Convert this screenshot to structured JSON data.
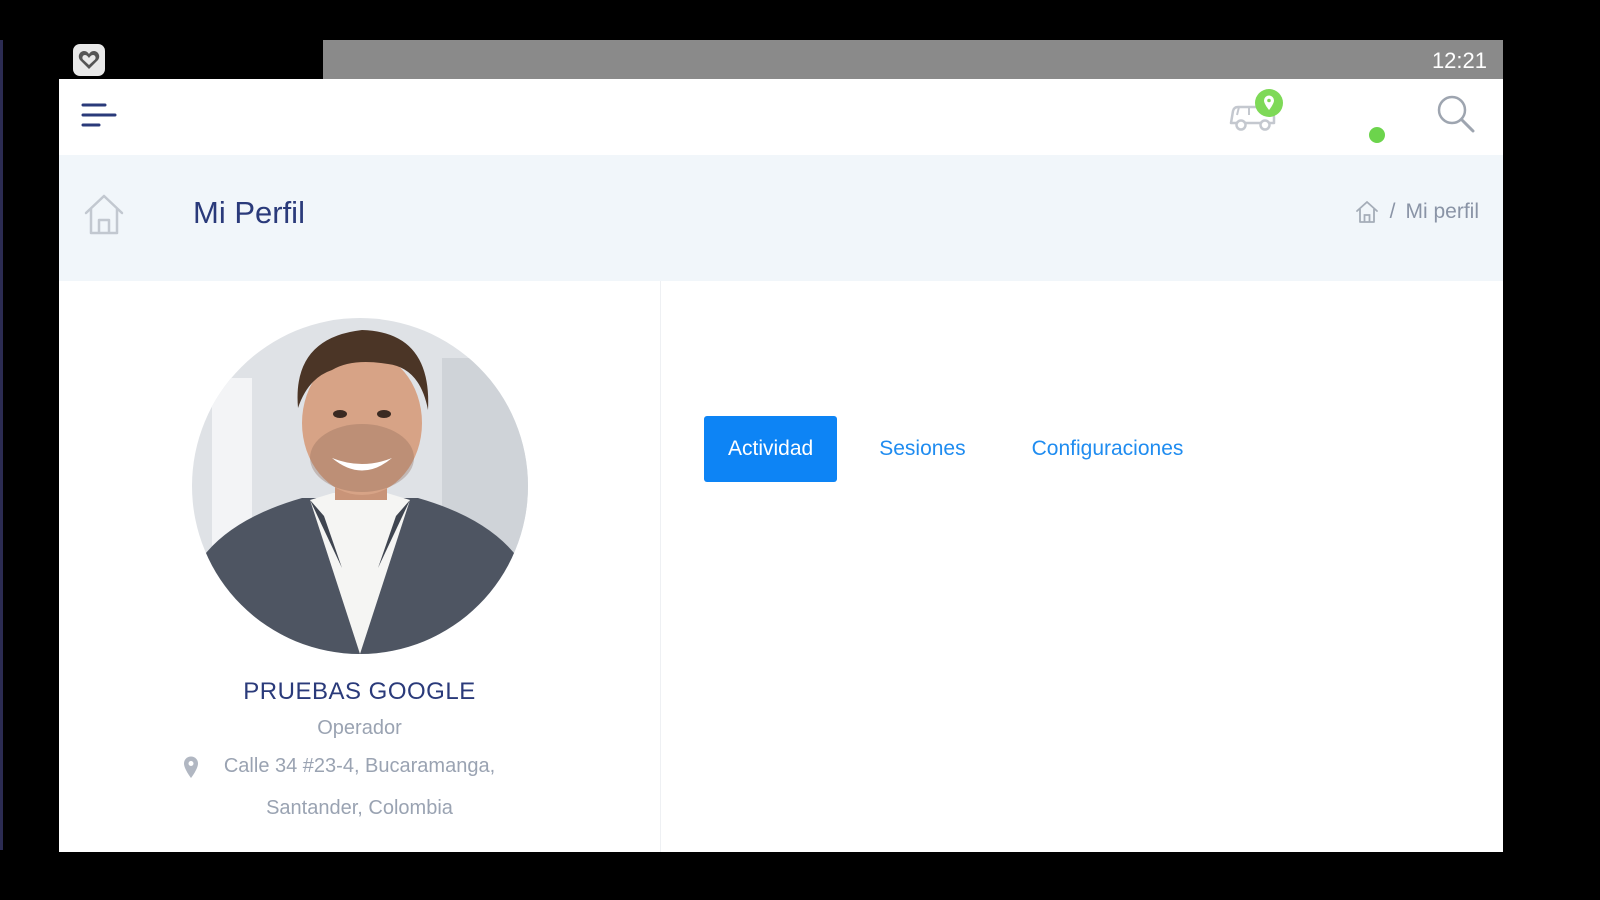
{
  "status_bar": {
    "time": "12:21"
  },
  "top_nav": {
    "truck_badge_count": ""
  },
  "page_header": {
    "title": "Mi Perfil",
    "breadcrumb": {
      "current": "Mi perfil",
      "separator": "/"
    }
  },
  "profile": {
    "name": "PRUEBAS GOOGLE",
    "role": "Operador",
    "address_line1": "Calle 34 #23-4, Bucaramanga,",
    "address_line2": "Santander, Colombia"
  },
  "tabs": [
    {
      "label": "Actividad",
      "active": true
    },
    {
      "label": "Sesiones",
      "active": false
    },
    {
      "label": "Configuraciones",
      "active": false
    }
  ],
  "colors": {
    "accent": "#0d84f5",
    "title": "#2a3a7a",
    "header_bg": "#f1f6fa",
    "online": "#6cd44c"
  },
  "icons": [
    "heart-icon",
    "menu-icon",
    "truck-icon",
    "search-icon",
    "home-icon",
    "location-pin-icon"
  ]
}
